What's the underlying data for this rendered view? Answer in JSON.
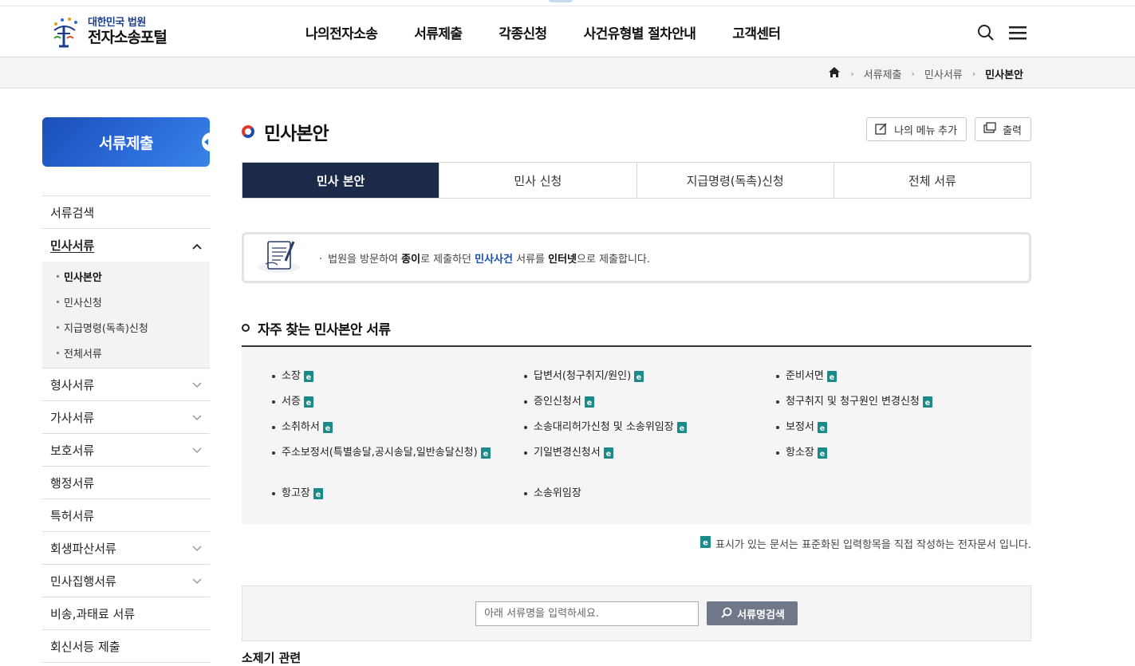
{
  "header": {
    "logo_sub": "대한민국 법원",
    "logo_main": "전자소송포털",
    "nav": [
      "나의전자소송",
      "서류제출",
      "각종신청",
      "사건유형별 절차안내",
      "고객센터"
    ]
  },
  "breadcrumb": {
    "items": [
      "서류제출",
      "민사서류"
    ],
    "current": "민사본안"
  },
  "sidebar": {
    "title": "서류제출",
    "items": [
      {
        "label": "서류검색"
      },
      {
        "label": "민사서류",
        "open": true
      },
      {
        "label": "형사서류"
      },
      {
        "label": "가사서류"
      },
      {
        "label": "보호서류"
      },
      {
        "label": "행정서류"
      },
      {
        "label": "특허서류"
      },
      {
        "label": "회생파산서류"
      },
      {
        "label": "민사집행서류"
      },
      {
        "label": "비송,과태료 서류"
      },
      {
        "label": "회신서등 제출"
      }
    ],
    "sub": [
      "민사본안",
      "민사신청",
      "지급명령(독촉)신청",
      "전체서류"
    ]
  },
  "page": {
    "title": "민사본안",
    "add_menu": "나의 메뉴 추가",
    "print": "출력",
    "tabs": [
      "민사 본안",
      "민사 신청",
      "지급명령(독촉)신청",
      "전체 서류"
    ]
  },
  "info": {
    "p1": "법원을 방문하여 ",
    "b1": "종이",
    "p2": "로 제출하던 ",
    "b2": "민사사건",
    "p3": " 서류를 ",
    "b3": "인터넷",
    "p4": "으로 제출합니다."
  },
  "docs": {
    "title": "자주 찾는 민사본안 서류",
    "col1": [
      {
        "name": "소장",
        "e": true
      },
      {
        "name": "서증",
        "e": true
      },
      {
        "name": "소취하서",
        "e": true
      },
      {
        "name": "주소보정서(특별송달,공시송달,일반송달신청)",
        "e": true
      },
      {
        "name": "항고장",
        "e": true
      }
    ],
    "col2": [
      {
        "name": "답변서(청구취지/원인)",
        "e": true
      },
      {
        "name": "증인신청서",
        "e": true
      },
      {
        "name": "소송대리허가신청 및 소송위임장",
        "e": true
      },
      {
        "name": "기일변경신청서",
        "e": true
      },
      {
        "name": "소송위임장",
        "e": false
      }
    ],
    "col3": [
      {
        "name": "준비서면",
        "e": true
      },
      {
        "name": "청구취지 및 청구원인 변경신청",
        "e": true
      },
      {
        "name": "보정서",
        "e": true
      },
      {
        "name": "항소장",
        "e": true
      }
    ],
    "legend": "표시가 있는 문서는 표준화된 입력항목을 직접 작성하는 전자문서 입니다."
  },
  "search": {
    "placeholder": "아래 서류명을 입력하세요.",
    "button": "서류명검색"
  },
  "subhead": "소제기 관련",
  "colors": {
    "tab_active": "#1c2a4a",
    "lnb": "#2c6ddc",
    "e_icon": "#1a8a8a"
  }
}
